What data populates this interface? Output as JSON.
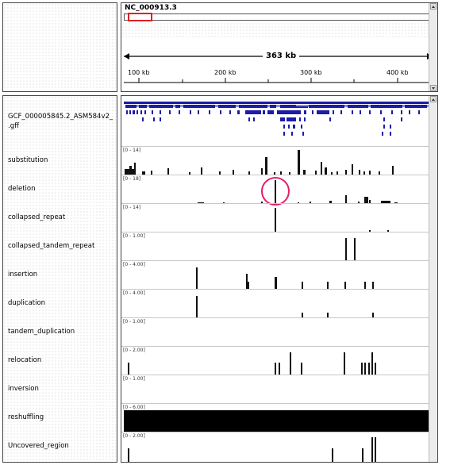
{
  "header": {
    "chromosome": "NC_000913.3",
    "span_label": "363 kb",
    "ruler_ticks": [
      "100 kb",
      "200 kb",
      "300 kb",
      "400 kb"
    ]
  },
  "annotation": {
    "name_line1": "GCF_000005845.2_ASM584v2_",
    "name_line2": ".gff"
  },
  "tracks": [
    {
      "name": "substitution",
      "range": "[0 - 14]"
    },
    {
      "name": "deletion",
      "range": "[0 - 18]"
    },
    {
      "name": "collapsed_repeat",
      "range": "[0 - 14]"
    },
    {
      "name": "collapsed_tandem_repeat",
      "range": "[0 - 1.00]"
    },
    {
      "name": "insertion",
      "range": "[0 - 4.00]"
    },
    {
      "name": "duplication",
      "range": "[0 - 4.00]"
    },
    {
      "name": "tandem_duplication",
      "range": "[0 - 1.00]"
    },
    {
      "name": "relocation",
      "range": "[0 - 2.00]"
    },
    {
      "name": "inversion",
      "range": "[0 - 1.00]"
    },
    {
      "name": "reshuffling",
      "range": "[0 - 6.00]"
    },
    {
      "name": "Uncovered_region",
      "range": "[0 - 2.00]"
    }
  ],
  "colors": {
    "gene_blue": "#1c1ca8",
    "highlight_red": "#e02020",
    "circle_magenta": "#e0206a",
    "bar_black": "#111111"
  }
}
